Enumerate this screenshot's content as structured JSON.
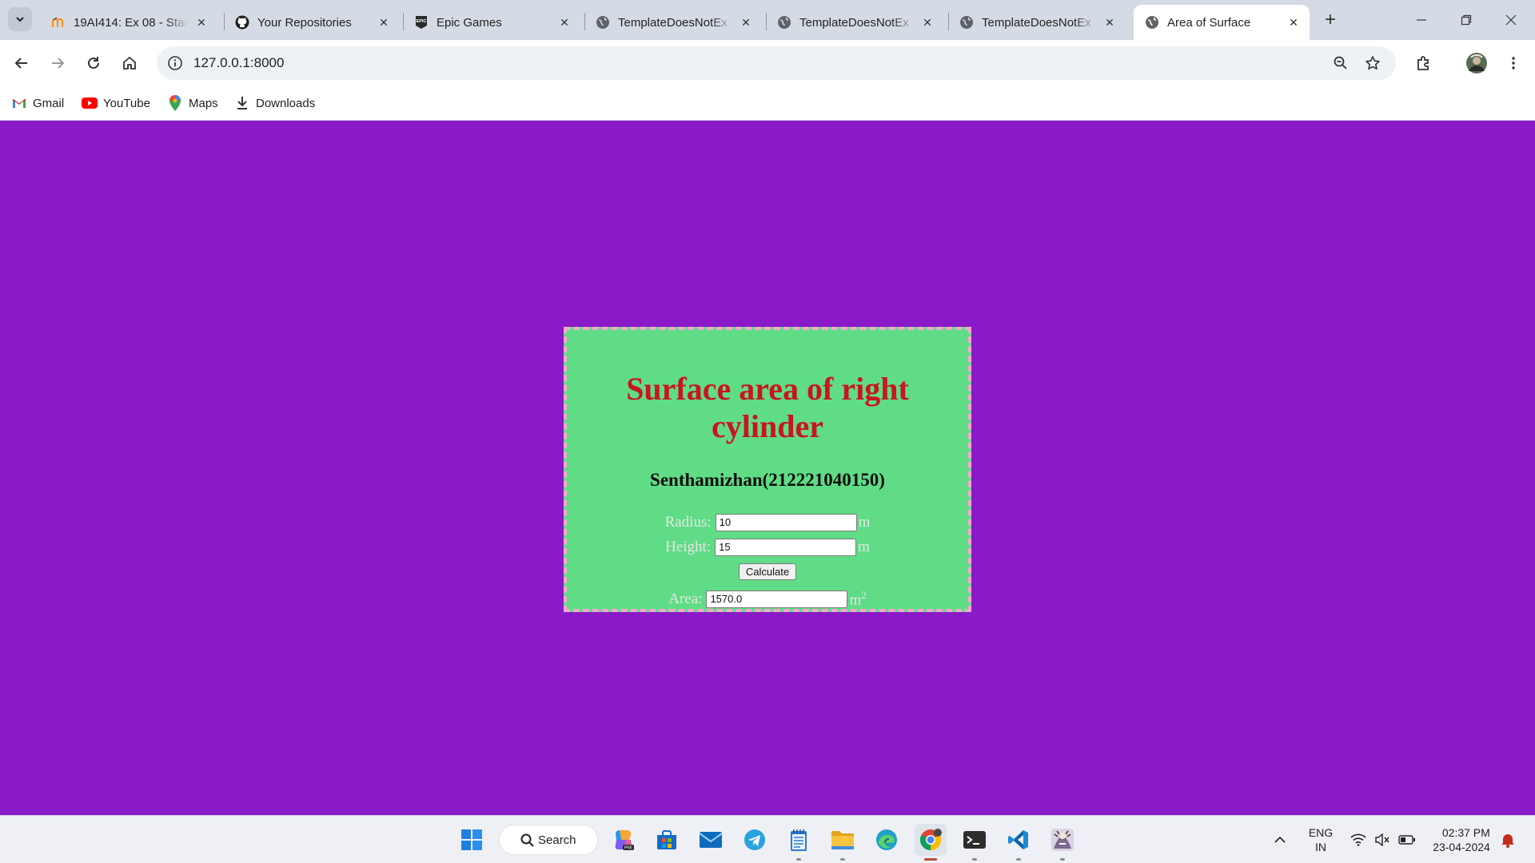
{
  "browser": {
    "tabs": [
      {
        "title": "19AI414: Ex 08 - Stan",
        "icon": "moodle-icon",
        "active": false
      },
      {
        "title": "Your Repositories",
        "icon": "github-icon",
        "active": false
      },
      {
        "title": "Epic Games",
        "icon": "epic-games-icon",
        "active": false
      },
      {
        "title": "TemplateDoesNotEx",
        "icon": "globe-icon",
        "active": false
      },
      {
        "title": "TemplateDoesNotEx",
        "icon": "globe-icon",
        "active": false
      },
      {
        "title": "TemplateDoesNotEx",
        "icon": "globe-icon",
        "active": false
      },
      {
        "title": "Area of Surface",
        "icon": "globe-icon",
        "active": true
      }
    ],
    "url": "127.0.0.1:8000",
    "bookmarks": [
      {
        "label": "Gmail",
        "icon": "gmail-icon"
      },
      {
        "label": "YouTube",
        "icon": "youtube-icon"
      },
      {
        "label": "Maps",
        "icon": "maps-icon"
      },
      {
        "label": "Downloads",
        "icon": "download-icon"
      }
    ]
  },
  "page": {
    "title": "Surface area of right cylinder",
    "author": "Senthamizhan(212221040150)",
    "radius_label": "Radius:",
    "radius_value": "10",
    "radius_unit": "m",
    "height_label": "Height:",
    "height_value": "15",
    "height_unit": "m",
    "calculate_label": "Calculate",
    "area_label": "Area:",
    "area_value": "1570.0",
    "area_unit": "m",
    "area_unit_exp": "2"
  },
  "colors": {
    "page_background": "#8a19c8",
    "card_background": "#60dc86",
    "card_border": "#f4a8cd",
    "title_color": "#c8161e"
  },
  "taskbar": {
    "search_label": "Search",
    "apps": [
      "start-icon",
      "copilot-icon",
      "store-icon",
      "mail-icon",
      "telegram-icon",
      "notepad-icon",
      "file-explorer-icon",
      "edge-icon",
      "chrome-icon",
      "terminal-icon",
      "vscode-icon",
      "game-icon"
    ],
    "language": "ENG",
    "region": "IN",
    "time": "02:37 PM",
    "date": "23-04-2024"
  }
}
